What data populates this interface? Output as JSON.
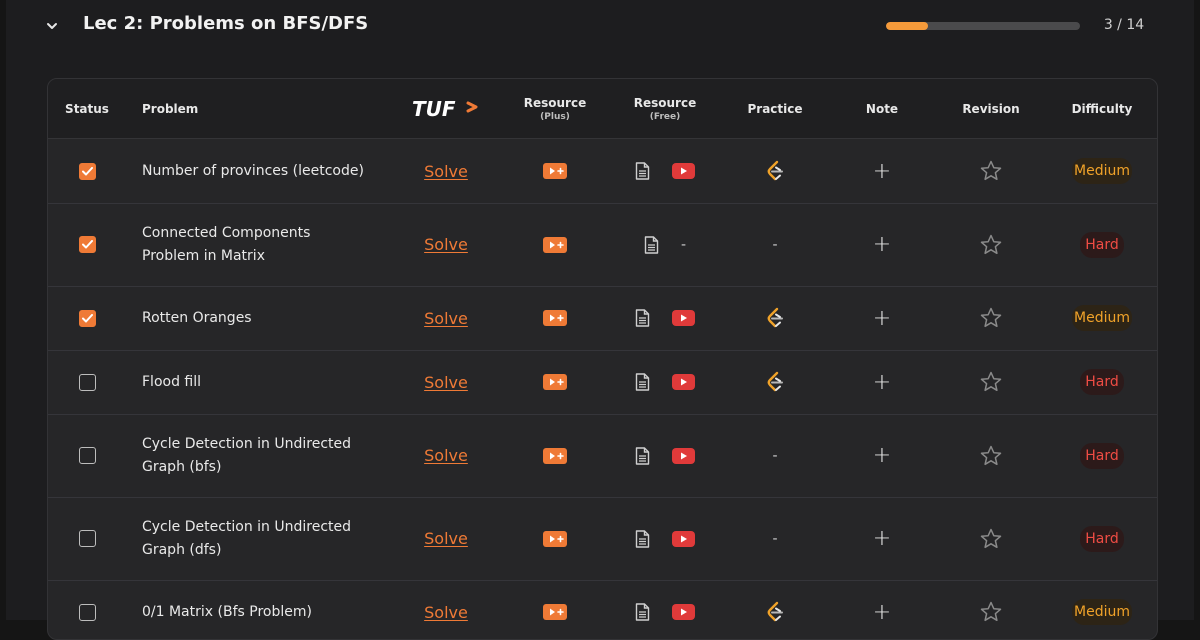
{
  "lecture": {
    "title": "Lec 2: Problems on BFS/DFS",
    "progress_text": "3 / 14",
    "progress_fraction": 0.214
  },
  "columns": {
    "status": "Status",
    "problem": "Problem",
    "tuf_logo": "TUF",
    "resource_plus": "Resource",
    "resource_plus_sub": "(Plus)",
    "resource_free": "Resource",
    "resource_free_sub": "(Free)",
    "practice": "Practice",
    "note": "Note",
    "revision": "Revision",
    "difficulty": "Difficulty"
  },
  "colors": {
    "accent": "#ef7a36",
    "medium": "#f0a229",
    "hard": "#ef4c44",
    "youtube": "#e03a3a"
  },
  "rows": [
    {
      "checked": true,
      "problem": "Number of provinces (leetcode)",
      "solve": "Solve",
      "article": true,
      "video": true,
      "free_dash": "",
      "practice": true,
      "practice_dash": "",
      "note": "+",
      "difficulty": "Medium",
      "level": "medium"
    },
    {
      "checked": true,
      "problem": "Connected Components Problem in Matrix",
      "solve": "Solve",
      "article": true,
      "video": false,
      "free_dash": "-",
      "practice": false,
      "practice_dash": "-",
      "note": "+",
      "difficulty": "Hard",
      "level": "hard"
    },
    {
      "checked": true,
      "problem": "Rotten Oranges",
      "solve": "Solve",
      "article": true,
      "video": true,
      "free_dash": "",
      "practice": true,
      "practice_dash": "",
      "note": "+",
      "difficulty": "Medium",
      "level": "medium"
    },
    {
      "checked": false,
      "problem": "Flood fill",
      "solve": "Solve",
      "article": true,
      "video": true,
      "free_dash": "",
      "practice": true,
      "practice_dash": "",
      "note": "+",
      "difficulty": "Hard",
      "level": "hard"
    },
    {
      "checked": false,
      "problem": "Cycle Detection in Undirected Graph (bfs)",
      "solve": "Solve",
      "article": true,
      "video": true,
      "free_dash": "",
      "practice": false,
      "practice_dash": "-",
      "note": "+",
      "difficulty": "Hard",
      "level": "hard"
    },
    {
      "checked": false,
      "problem": "Cycle Detection in Undirected Graph (dfs)",
      "solve": "Solve",
      "article": true,
      "video": true,
      "free_dash": "",
      "practice": false,
      "practice_dash": "-",
      "note": "+",
      "difficulty": "Hard",
      "level": "hard"
    },
    {
      "checked": false,
      "problem": "0/1 Matrix (Bfs Problem)",
      "solve": "Solve",
      "article": true,
      "video": true,
      "free_dash": "",
      "practice": true,
      "practice_dash": "",
      "note": "+",
      "difficulty": "Medium",
      "level": "medium"
    }
  ]
}
